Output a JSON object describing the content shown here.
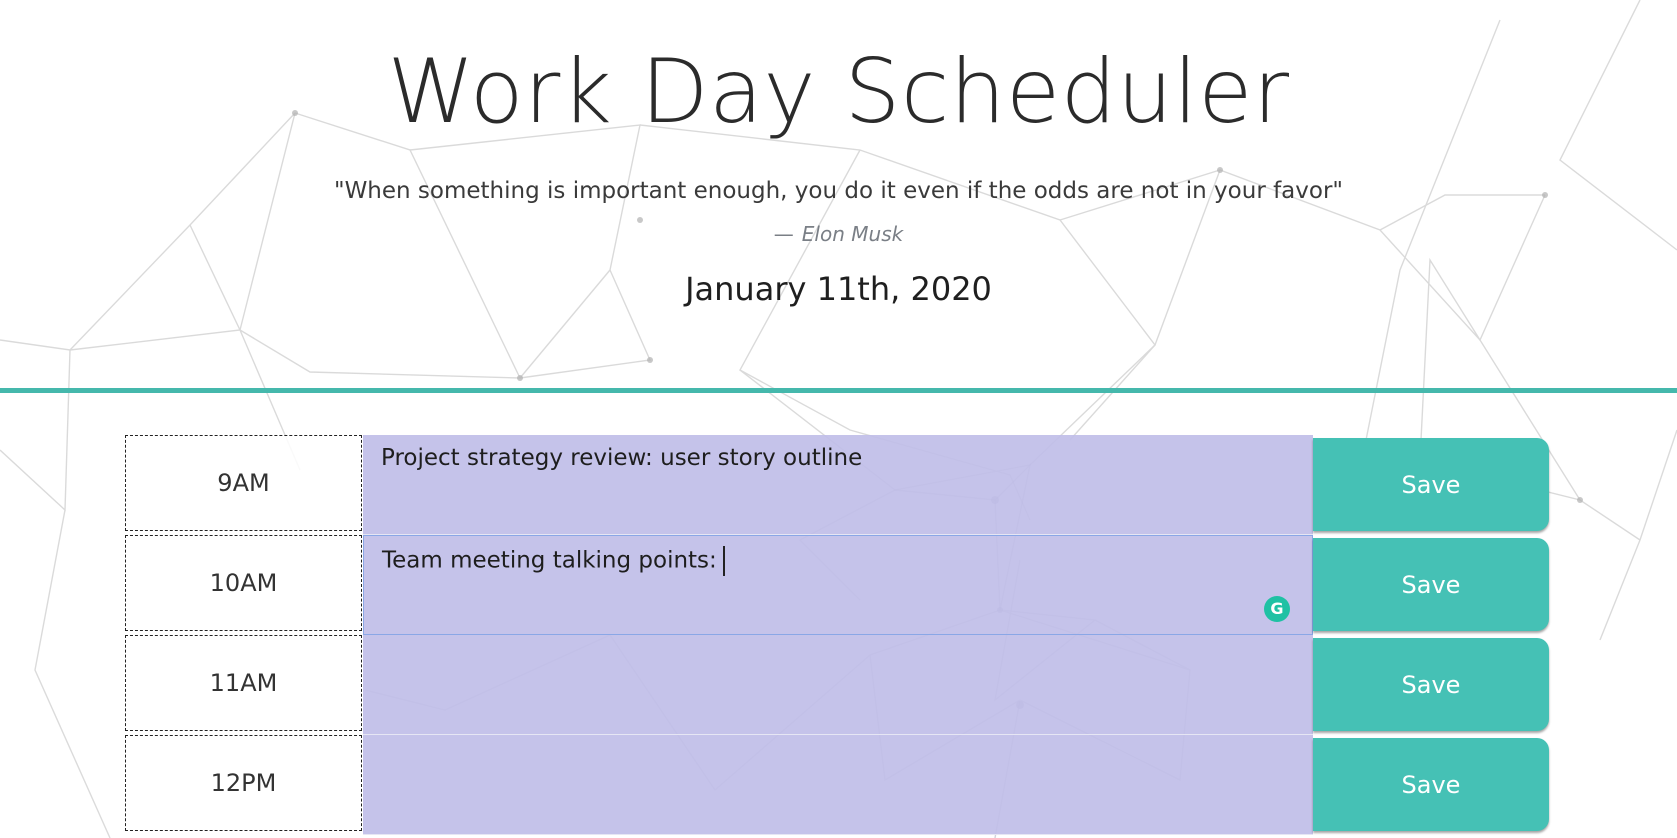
{
  "header": {
    "title": "Work Day Scheduler",
    "quote": "\"When something is important enough, you do it even if the odds are not in your favor\"",
    "author_dash": "—",
    "author": "Elon Musk",
    "date": "January 11th, 2020"
  },
  "colors": {
    "accent": "#45b8ac",
    "save_button": "#45c1b5",
    "task_background": "#c5c3e8"
  },
  "schedule": [
    {
      "hour": "9AM",
      "task": "Project strategy review: user story outline",
      "save_label": "Save"
    },
    {
      "hour": "10AM",
      "task": "Team meeting talking points:",
      "save_label": "Save"
    },
    {
      "hour": "11AM",
      "task": "",
      "save_label": "Save"
    },
    {
      "hour": "12PM",
      "task": "",
      "save_label": "Save"
    }
  ],
  "icons": {
    "grammarly": "grammarly-icon"
  }
}
